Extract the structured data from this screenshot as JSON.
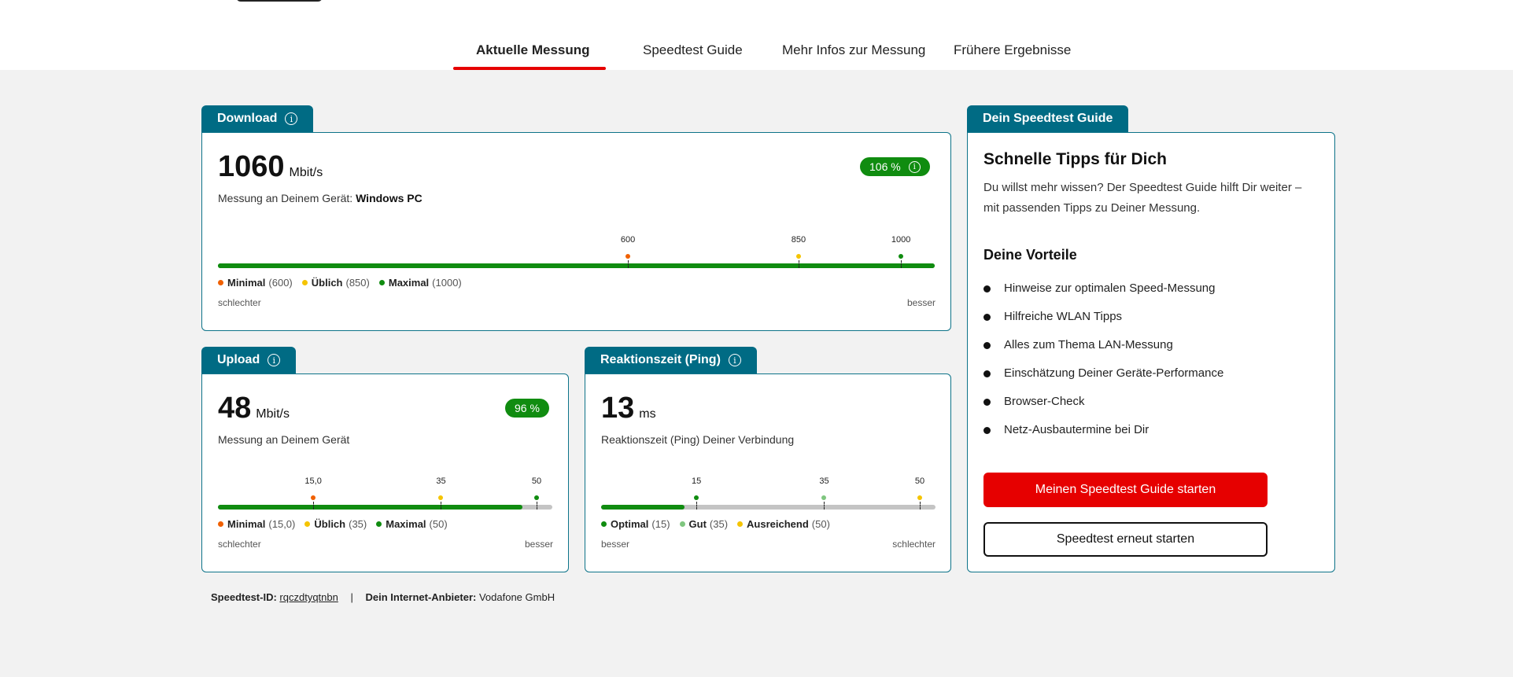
{
  "tabs": [
    {
      "label": "Aktuelle Messung"
    },
    {
      "label": "Speedtest Guide"
    },
    {
      "label": "Mehr Infos zur Messung"
    },
    {
      "label": "Frühere Ergebnisse"
    }
  ],
  "colors": {
    "accent_red": "#e60000",
    "teal": "#006b84",
    "green": "#108c10",
    "orange": "#f06000",
    "yellow": "#f5c400",
    "light_green": "#7fc67f"
  },
  "download": {
    "tab_label": "Download",
    "value": "1060",
    "unit": "Mbit/s",
    "device_prefix": "Messung an Deinem Gerät:",
    "device": "Windows PC",
    "percent": "106 %",
    "fill_fraction": 1.0,
    "markers": [
      {
        "label": "600",
        "color": "#f06000",
        "fraction": 0.572
      },
      {
        "label": "850",
        "color": "#f5c400",
        "fraction": 0.81
      },
      {
        "label": "1000",
        "color": "#108c10",
        "fraction": 0.953
      }
    ],
    "legend": [
      {
        "name": "Minimal",
        "value": "(600)",
        "color": "#f06000"
      },
      {
        "name": "Üblich",
        "value": "(850)",
        "color": "#f5c400"
      },
      {
        "name": "Maximal",
        "value": "(1000)",
        "color": "#108c10"
      }
    ],
    "left_label": "schlechter",
    "right_label": "besser"
  },
  "upload": {
    "tab_label": "Upload",
    "value": "48",
    "unit": "Mbit/s",
    "device_text": "Messung an Deinem Gerät",
    "percent": "96 %",
    "fill_fraction": 0.91,
    "markers": [
      {
        "label": "15,0",
        "color": "#f06000",
        "fraction": 0.285
      },
      {
        "label": "35",
        "color": "#f5c400",
        "fraction": 0.667
      },
      {
        "label": "50",
        "color": "#108c10",
        "fraction": 0.953
      }
    ],
    "legend": [
      {
        "name": "Minimal",
        "value": "(15,0)",
        "color": "#f06000"
      },
      {
        "name": "Üblich",
        "value": "(35)",
        "color": "#f5c400"
      },
      {
        "name": "Maximal",
        "value": "(50)",
        "color": "#108c10"
      }
    ],
    "left_label": "schlechter",
    "right_label": "besser"
  },
  "ping": {
    "tab_label": "Reaktionszeit (Ping)",
    "value": "13",
    "unit": "ms",
    "device_text": "Reaktionszeit (Ping) Deiner Verbindung",
    "fill_fraction": 0.25,
    "markers": [
      {
        "label": "15",
        "color": "#108c10",
        "fraction": 0.285
      },
      {
        "label": "35",
        "color": "#7fc67f",
        "fraction": 0.667
      },
      {
        "label": "50",
        "color": "#f5c400",
        "fraction": 0.953
      }
    ],
    "legend": [
      {
        "name": "Optimal",
        "value": "(15)",
        "color": "#108c10"
      },
      {
        "name": "Gut",
        "value": "(35)",
        "color": "#7fc67f"
      },
      {
        "name": "Ausreichend",
        "value": "(50)",
        "color": "#f5c400"
      }
    ],
    "left_label": "besser",
    "right_label": "schlechter"
  },
  "guide": {
    "tab_label": "Dein Speedtest Guide",
    "title": "Schnelle Tipps für Dich",
    "text": "Du willst mehr wissen? Der Speedtest Guide hilft Dir weiter – mit passenden Tipps zu Deiner Messung.",
    "benefits_title": "Deine Vorteile",
    "benefits": [
      "Hinweise zur optimalen Speed-Messung",
      "Hilfreiche WLAN Tipps",
      "Alles zum Thema LAN-Messung",
      "Einschätzung Deiner Geräte-Performance",
      "Browser-Check",
      "Netz-Ausbautermine bei Dir"
    ],
    "primary_button": "Meinen Speedtest Guide starten",
    "secondary_button": "Speedtest erneut starten"
  },
  "footer": {
    "id_label": "Speedtest-ID:",
    "id_value": "rqczdtyqtnbn",
    "separator": "|",
    "provider_label": "Dein Internet-Anbieter:",
    "provider_value": "Vodafone GmbH"
  }
}
